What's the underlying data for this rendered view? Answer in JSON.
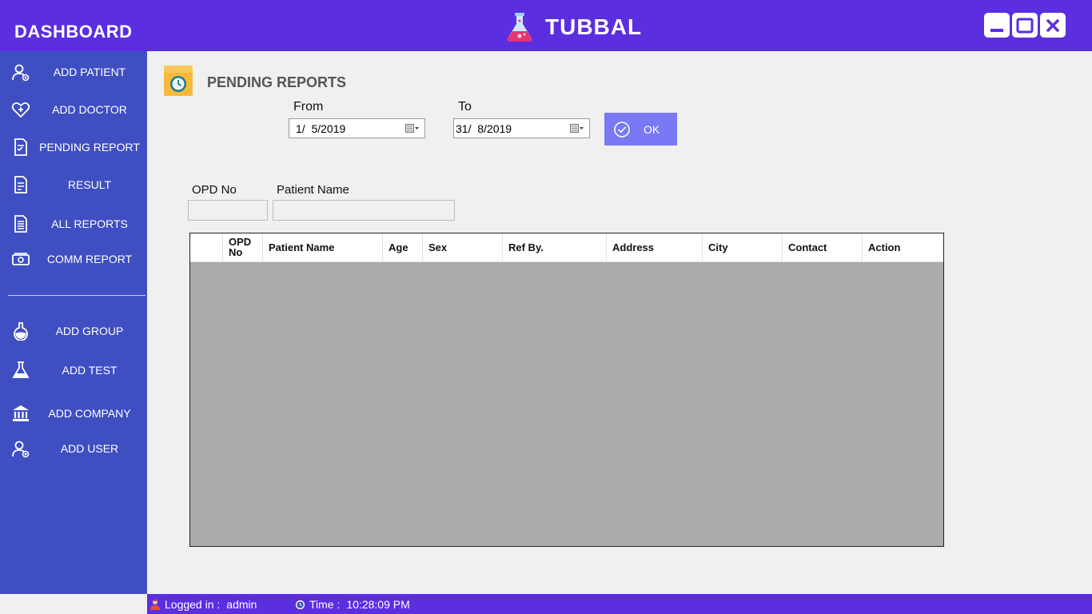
{
  "header": {
    "dashboard_title": "DASHBOARD",
    "brand": "TUBBAL"
  },
  "sidebar": {
    "items": [
      {
        "label": "ADD PATIENT",
        "icon": "user-add-icon"
      },
      {
        "label": "ADD DOCTOR",
        "icon": "heart-plus-icon"
      },
      {
        "label": "PENDING REPORT",
        "icon": "report-check-icon"
      },
      {
        "label": "RESULT",
        "icon": "document-icon"
      },
      {
        "label": "ALL REPORTS",
        "icon": "document-lines-icon"
      },
      {
        "label": "COMM REPORT",
        "icon": "money-icon"
      },
      {
        "label": "ADD GROUP",
        "icon": "flask-round-icon"
      },
      {
        "label": "ADD TEST",
        "icon": "flask-icon"
      },
      {
        "label": "ADD COMPANY",
        "icon": "bank-icon"
      },
      {
        "label": "ADD USER",
        "icon": "user-add-icon"
      }
    ]
  },
  "page": {
    "title": "PENDING REPORTS",
    "from_label": "From",
    "to_label": "To",
    "from_date": "1/  5/2019",
    "to_date": "31/  8/2019",
    "ok_label": "OK",
    "opd_label": "OPD No",
    "patient_name_label": "Patient Name",
    "opd_value": "",
    "patient_name_value": ""
  },
  "table": {
    "columns": [
      "",
      "OPD\nNo",
      "Patient Name",
      "Age",
      "Sex",
      "Ref By.",
      "Address",
      "City",
      "Contact",
      "Action"
    ],
    "rows": []
  },
  "status": {
    "logged_in_label": "Logged in :",
    "user": "admin",
    "time_label": "Time :",
    "time": "10:28:09 PM"
  },
  "colors": {
    "topbar": "#5b2ee0",
    "sidebar": "#3f4fc2",
    "ok_button": "#7b78f5",
    "grid_empty": "#ababab"
  }
}
